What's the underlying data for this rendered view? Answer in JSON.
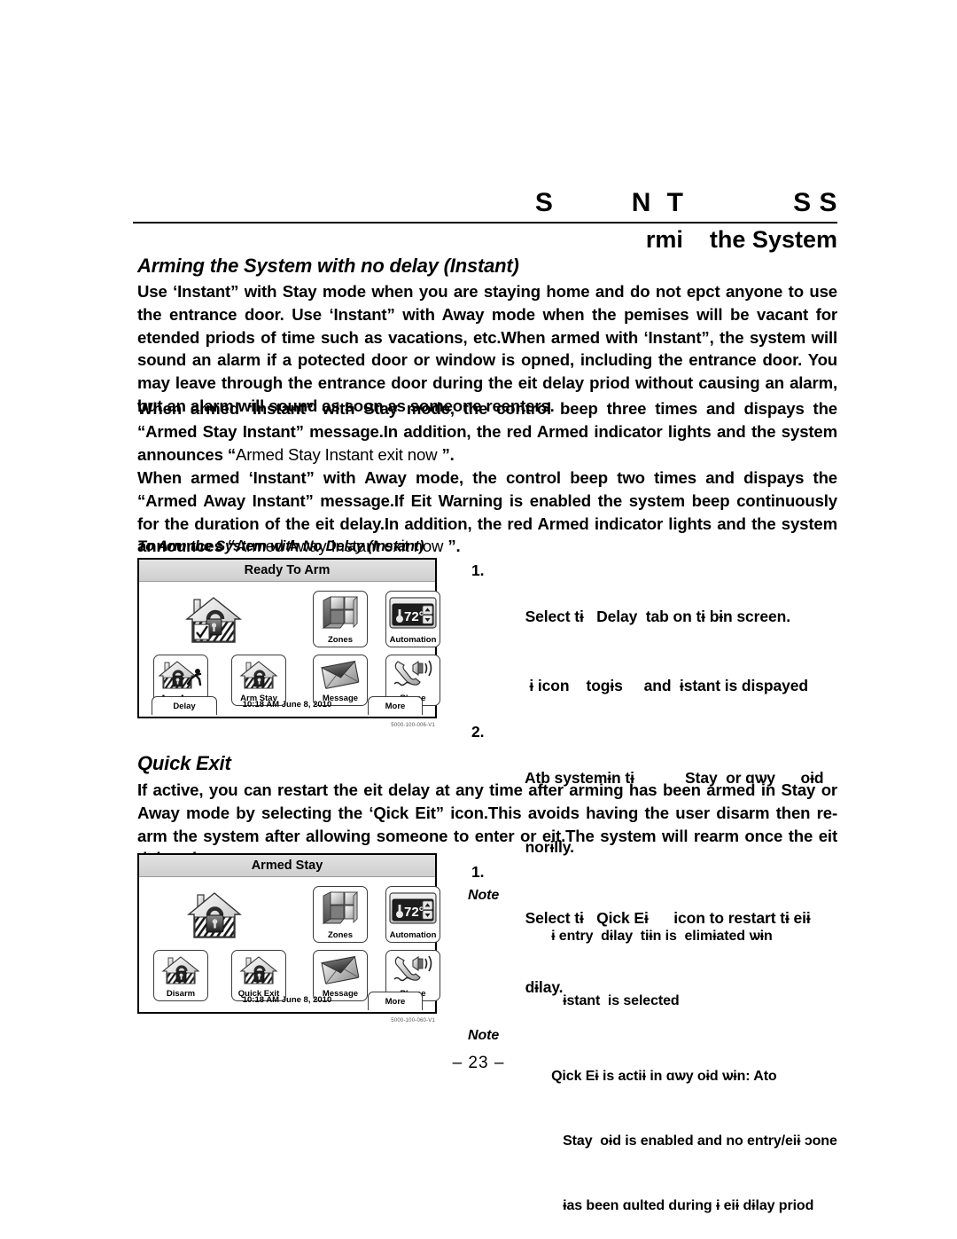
{
  "running_head": {
    "line1": "S          N  T              S S",
    "line2": "rmi    the System"
  },
  "sections": {
    "instant": {
      "heading": "Arming the System with no delay (Instant)",
      "paragraphs": [
        "Use ‘Instant” with Stay mode when you are staying home and do not epct anyone to use the entrance door.  Use ‘Instant” with Away mode when the pemises will be vacant for etended priods of time such as vacations, etc.When armed with ‘Instant”, the system will sound an alarm if a potected door or window is opned, including the entrance door. You may leave through the entrance door during the eit delay priod without causing an alarm, but an alarm will sound as soon as someone reenters.",
        "When armed ‘Instant” with Stay mode, the control beep three times and dispays the “Armed Stay Instant” message.In addition, the red Armed indicator lights and the system announces “Armed Stay Instant exit now    ”.",
        "When armed ‘Instant” with Away mode, the control beep two times and dispays the “Armed Away Instant” message.If Eit Warning is enabled the system beep continuously for the duration of the eit delay.In addition, the red Armed indicator lights and the system announces “Armed Away Instant exit now    ”."
      ],
      "announce_thin_1": "Armed Stay Instant exit now",
      "announce_thin_2": "Armed Away Instant exit now",
      "figure_caption": "To Arm the System with No Delay (Instant)",
      "steps": [
        {
          "num": "1.",
          "lines": [
            "Select tɨ   Delay  tab on tɨ bɨn screen.",
            " ɨ icon    togɨs     and  ɨstant is dispayed"
          ]
        },
        {
          "num": "2.",
          "lines": [
            "Atb systemɨn tɨ            Stay  or ɑѡy      oɨd",
            "norɨlly."
          ]
        }
      ],
      "note": {
        "label": "Note",
        "lines": [
          "ɨ entry  dɨlay  tiɨn is  elimɨated ѡɨn",
          "   ɨstant  is selected"
        ]
      }
    },
    "quick_exit": {
      "heading": "Quick Exit",
      "paragraph": "If active, you can restart the eit delay at any time after arming has been armed in Stay or Away mode by selecting the ‘Qick Eit” icon.This avoids having the user disarm then re-arm the system after allowing someone to enter or eit.The system will rearm once the eit delay eipres.",
      "steps": [
        {
          "num": "1.",
          "lines": [
            "Select tɨ   Qick Eɨ      icon to restart tɨ eiɨ",
            "dɨlay."
          ]
        }
      ],
      "note": {
        "label": "Note",
        "lines": [
          "Qick Eɨ is actiɨ in ɑѡy oɨd ѡɨn: Ato",
          "   Stay  oɨd is enabled and no entry/eiɨ ɔone",
          "   ɨas been ɑulted during ɨ eiɨ dɨlay priod"
        ]
      }
    }
  },
  "panel_ready": {
    "title": "Ready To Arm",
    "status_icon": "house-unlocked-check-icon",
    "tiles": [
      {
        "label": "Zones",
        "icon": "zones-grid-icon"
      },
      {
        "label": "Automation",
        "icon": "thermostat-icon",
        "temp": "72°"
      },
      {
        "label": "Arm Away",
        "icon": "house-running-person-icon"
      },
      {
        "label": "Arm Stay",
        "icon": "house-lock-icon"
      },
      {
        "label": "Message",
        "icon": "envelope-icon"
      },
      {
        "label": "Phone",
        "icon": "phone-speaker-icon"
      }
    ],
    "left_tab": "Delay",
    "time": "10:18 AM June 8, 2010",
    "right_tab": "More",
    "part_number": "5000-100-006-V1"
  },
  "panel_armed": {
    "title": "Armed Stay",
    "status_icon": "house-locked-icon",
    "tiles": [
      {
        "label": "Zones",
        "icon": "zones-grid-icon"
      },
      {
        "label": "Automation",
        "icon": "thermostat-icon",
        "temp": "72°"
      },
      {
        "label": "Disarm",
        "icon": "house-lock-icon"
      },
      {
        "label": "Quick Exit",
        "icon": "house-lock-icon"
      },
      {
        "label": "Message",
        "icon": "envelope-icon"
      },
      {
        "label": "Phone",
        "icon": "phone-speaker-icon"
      }
    ],
    "time": "10:18 AM June 8, 2010",
    "right_tab": "More",
    "part_number": "5000-100-060-V1"
  },
  "footer": {
    "page_number": "– 23 –"
  }
}
